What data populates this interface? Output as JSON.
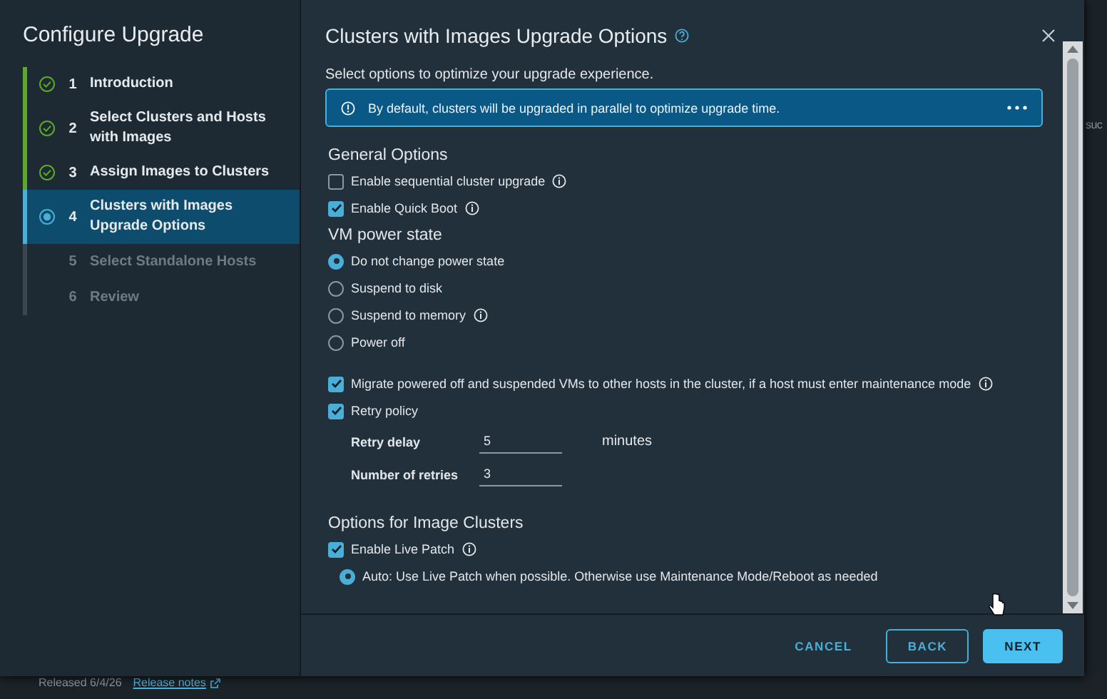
{
  "background": {
    "edge_text": "suc",
    "footer_text": "Released 6/4/26",
    "footer_link": "Release notes"
  },
  "wizard": {
    "title": "Configure Upgrade",
    "steps": [
      {
        "number": "1",
        "label": "Introduction",
        "completed": true,
        "selected": false
      },
      {
        "number": "2",
        "label": "Select Clusters and Hosts with Images",
        "completed": true,
        "selected": false
      },
      {
        "number": "3",
        "label": "Assign Images to Clusters",
        "completed": true,
        "selected": false
      },
      {
        "number": "4",
        "label": "Clusters with Images Upgrade Options",
        "completed": false,
        "selected": true
      },
      {
        "number": "5",
        "label": "Select Standalone Hosts",
        "completed": false,
        "selected": false
      },
      {
        "number": "6",
        "label": "Review",
        "completed": false,
        "selected": false
      }
    ]
  },
  "panel": {
    "title": "Clusters with Images Upgrade Options",
    "intro": "Select options to optimize your upgrade experience.",
    "alert": "By default, clusters will be upgraded in parallel to optimize upgrade time.",
    "general": {
      "heading": "General Options",
      "options": [
        {
          "label": "Enable sequential cluster upgrade",
          "checked": false,
          "info": true
        },
        {
          "label": "Enable Quick Boot",
          "checked": true,
          "info": true
        }
      ]
    },
    "power": {
      "heading": "VM power state",
      "options": [
        {
          "label": "Do not change power state",
          "selected": true,
          "info": false
        },
        {
          "label": "Suspend to disk",
          "selected": false,
          "info": false
        },
        {
          "label": "Suspend to memory",
          "selected": false,
          "info": true
        },
        {
          "label": "Power off",
          "selected": false,
          "info": false
        }
      ]
    },
    "migrate": {
      "label": "Migrate powered off and suspended VMs to other hosts in the cluster, if a host must enter maintenance mode",
      "checked": true,
      "info": true
    },
    "retry": {
      "label": "Retry policy",
      "checked": true,
      "fields": [
        {
          "label": "Retry delay",
          "value": "5",
          "unit": "minutes"
        },
        {
          "label": "Number of retries",
          "value": "3"
        }
      ]
    },
    "image": {
      "heading": "Options for Image Clusters",
      "live_patch": {
        "label": "Enable Live Patch",
        "checked": true,
        "info": true
      },
      "mode": {
        "label": "Auto: Use Live Patch when possible. Otherwise use Maintenance Mode/Reboot as needed",
        "selected": true
      }
    }
  },
  "buttons": [
    {
      "label": "CANCEL",
      "kind": "link"
    },
    {
      "label": "BACK",
      "kind": "outline"
    },
    {
      "label": "NEXT",
      "kind": "primary"
    }
  ]
}
